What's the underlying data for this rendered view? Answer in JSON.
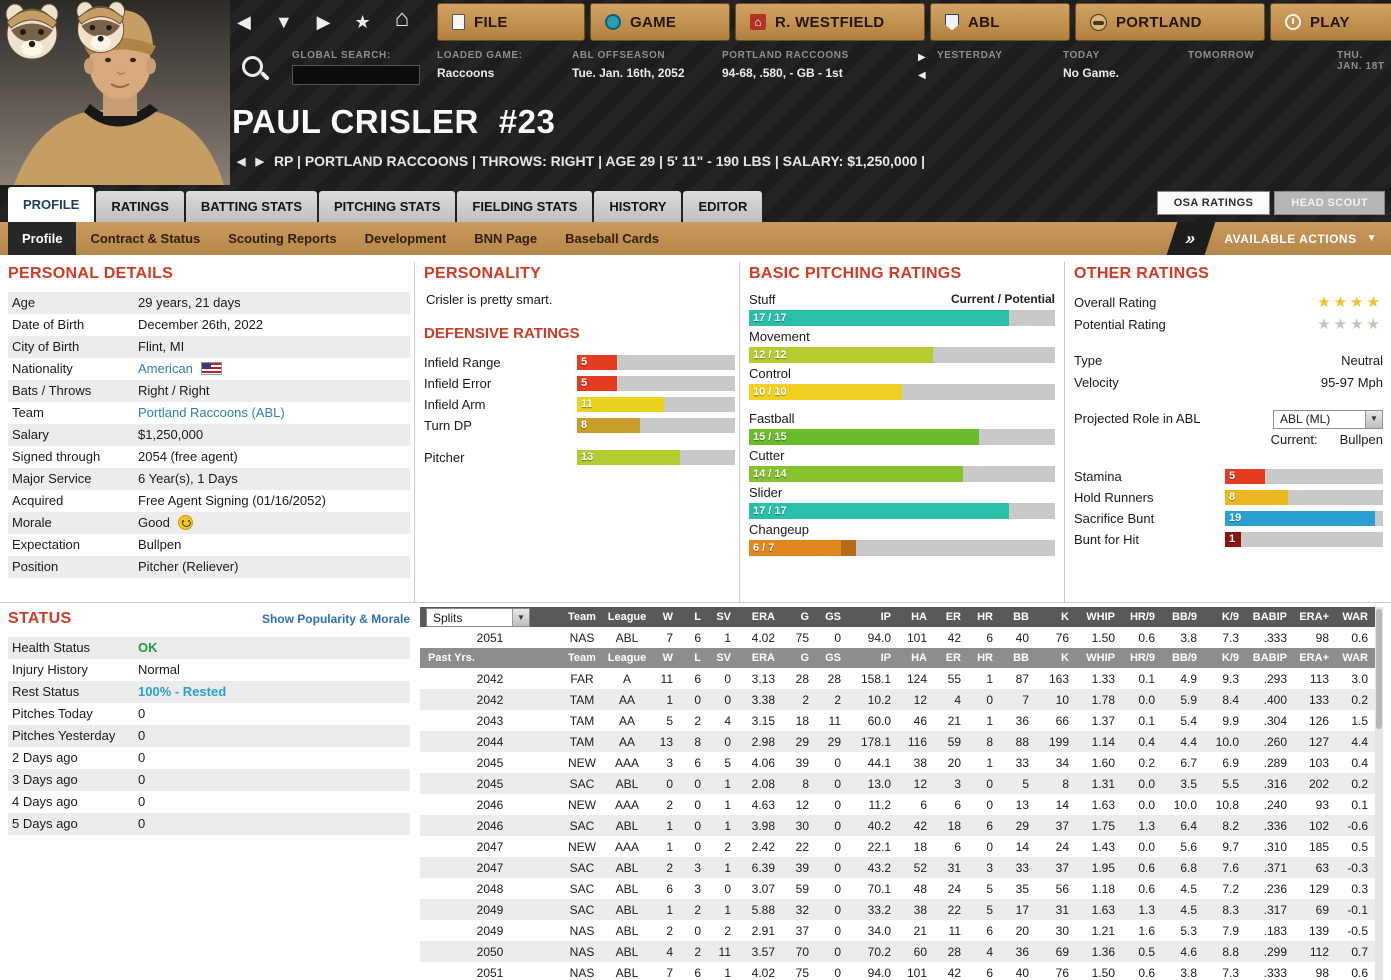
{
  "topbar": {
    "nav_icons": [
      {
        "name": "back-icon",
        "glyph": "◀"
      },
      {
        "name": "dropdown-icon",
        "glyph": "▼"
      },
      {
        "name": "forward-icon",
        "glyph": "▶"
      },
      {
        "name": "favorites-icon",
        "glyph": "★"
      },
      {
        "name": "home-icon",
        "glyph": "⌂"
      }
    ],
    "menus": [
      {
        "id": "file",
        "label": "FILE",
        "icon": "file-icon"
      },
      {
        "id": "game",
        "label": "GAME",
        "icon": "globe-icon"
      },
      {
        "id": "manager",
        "label": "R. WESTFIELD",
        "icon": "house-icon"
      },
      {
        "id": "league",
        "label": "ABL",
        "icon": "league-logo-icon"
      },
      {
        "id": "team",
        "label": "PORTLAND",
        "icon": "team-logo-icon"
      },
      {
        "id": "play",
        "label": "PLAY",
        "icon": "play-icon"
      }
    ]
  },
  "infobar": {
    "search_label": "GLOBAL SEARCH:",
    "search_value": "",
    "loaded_label": "LOADED GAME:",
    "loaded_value": "Raccoons",
    "league_label": "ABL OFFSEASON",
    "league_value": "Tue. Jan. 16th, 2052",
    "team_label": "PORTLAND RACCOONS",
    "team_value": "94-68, .580, - GB - 1st",
    "yesterday_label": "YESTERDAY",
    "today_label": "TODAY",
    "today_value": "No Game.",
    "tomorrow_label": "TOMORROW",
    "next_label": "THU. JAN. 18T"
  },
  "player": {
    "name": "PAUL CRISLER",
    "number": "#23",
    "subtitle": "RP | PORTLAND RACCOONS | THROWS: RIGHT | AGE 29 | 5' 11\" - 190 LBS | SALARY: $1,250,000 |"
  },
  "tabs": [
    {
      "label": "PROFILE",
      "active": true
    },
    {
      "label": "RATINGS"
    },
    {
      "label": "BATTING STATS"
    },
    {
      "label": "PITCHING STATS"
    },
    {
      "label": "FIELDING STATS"
    },
    {
      "label": "HISTORY"
    },
    {
      "label": "EDITOR"
    }
  ],
  "header_buttons": [
    {
      "label": "OSA RATINGS",
      "active": true
    },
    {
      "label": "HEAD SCOUT"
    }
  ],
  "subtabs": [
    {
      "label": "Profile",
      "active": true
    },
    {
      "label": "Contract & Status"
    },
    {
      "label": "Scouting Reports"
    },
    {
      "label": "Development"
    },
    {
      "label": "BNN Page"
    },
    {
      "label": "Baseball Cards"
    }
  ],
  "available_actions_label": "AVAILABLE ACTIONS",
  "personal_details": {
    "title": "PERSONAL DETAILS",
    "rows": [
      {
        "label": "Age",
        "value": "29 years, 21 days"
      },
      {
        "label": "Date of Birth",
        "value": "December 26th, 2022"
      },
      {
        "label": "City of Birth",
        "value": "Flint, MI"
      },
      {
        "label": "Nationality",
        "value": "American",
        "link": true,
        "suffix": "flag"
      },
      {
        "label": "Bats / Throws",
        "value": "Right / Right"
      },
      {
        "label": "Team",
        "value": "Portland Raccoons (ABL)",
        "link": true
      },
      {
        "label": "Salary",
        "value": "$1,250,000"
      },
      {
        "label": "Signed through",
        "value": "2054 (free agent)"
      },
      {
        "label": "Major Service",
        "value": "6 Year(s), 1 Days"
      },
      {
        "label": "Acquired",
        "value": "Free Agent Signing (01/16/2052)"
      },
      {
        "label": "Morale",
        "value": "Good",
        "suffix": "smiley"
      },
      {
        "label": "Expectation",
        "value": "Bullpen"
      },
      {
        "label": "Position",
        "value": "Pitcher (Reliever)"
      }
    ]
  },
  "personality": {
    "title": "PERSONALITY",
    "text": "Crisler is pretty smart.",
    "defensive_title": "DEFENSIVE RATINGS",
    "ratings": [
      {
        "label": "Infield Range",
        "value": 5,
        "color": "#e23d1f"
      },
      {
        "label": "Infield Error",
        "value": 5,
        "color": "#e23d1f"
      },
      {
        "label": "Infield Arm",
        "value": 11,
        "color": "#ead31f"
      },
      {
        "label": "Turn DP",
        "value": 8,
        "color": "#c79e2b"
      },
      {
        "label": "Pitcher",
        "value": 13,
        "color": "#b5cc30",
        "gap": true
      }
    ]
  },
  "pitching": {
    "title": "BASIC PITCHING RATINGS",
    "header_right": "Current / Potential",
    "ratings": [
      {
        "label": "Stuff",
        "current": 17,
        "potential": 17,
        "color": "#29bfa8"
      },
      {
        "label": "Movement",
        "current": 12,
        "potential": 12,
        "color": "#b8cc30"
      },
      {
        "label": "Control",
        "current": 10,
        "potential": 10,
        "color": "#f0d122"
      },
      {
        "label": "Fastball",
        "current": 15,
        "potential": 15,
        "color": "#68bb2a",
        "gap": true
      },
      {
        "label": "Cutter",
        "current": 14,
        "potential": 14,
        "color": "#86c22b"
      },
      {
        "label": "Slider",
        "current": 17,
        "potential": 17,
        "color": "#29bfa8"
      },
      {
        "label": "Changeup",
        "current": 6,
        "potential": 7,
        "color": "#e2861f",
        "potential_color": "#b96a15"
      }
    ]
  },
  "other": {
    "title": "OTHER RATINGS",
    "overall_label": "Overall Rating",
    "overall_stars": {
      "count": 4,
      "color": "#f0c222"
    },
    "potential_label": "Potential Rating",
    "potential_stars": {
      "count": 4,
      "color": "#cbc2b4"
    },
    "type_label": "Type",
    "type_value": "Neutral",
    "velocity_label": "Velocity",
    "velocity_value": "95-97 Mph",
    "projected_label": "Projected Role in ABL",
    "projected_value": "ABL (ML)",
    "current_label": "Current:",
    "current_value": "Bullpen",
    "bars": [
      {
        "label": "Stamina",
        "value": 5,
        "color": "#e23d1f"
      },
      {
        "label": "Hold Runners",
        "value": 8,
        "color": "#eab81e"
      },
      {
        "label": "Sacrifice Bunt",
        "value": 19,
        "color": "#2b9fd1"
      },
      {
        "label": "Bunt for Hit",
        "value": 1,
        "color": "#8c1511"
      }
    ]
  },
  "status": {
    "title": "STATUS",
    "link": "Show Popularity & Morale",
    "rows": [
      {
        "label": "Health Status",
        "value": "OK",
        "color": "#1e9e40"
      },
      {
        "label": "Injury History",
        "value": "Normal"
      },
      {
        "label": "Rest Status",
        "value": "100% - Rested",
        "color": "#2a9fd4"
      },
      {
        "label": "Pitches Today",
        "value": "0"
      },
      {
        "label": "Pitches Yesterday",
        "value": "0"
      },
      {
        "label": "2 Days ago",
        "value": "0"
      },
      {
        "label": "3 Days ago",
        "value": "0"
      },
      {
        "label": "4 Days ago",
        "value": "0"
      },
      {
        "label": "5 Days ago",
        "value": "0"
      }
    ]
  },
  "stats": {
    "splits_label": "Splits",
    "past_label": "Past Yrs.",
    "columns": [
      "Team",
      "League",
      "W",
      "L",
      "SV",
      "ERA",
      "G",
      "GS",
      "IP",
      "HA",
      "ER",
      "HR",
      "BB",
      "K",
      "WHIP",
      "HR/9",
      "BB/9",
      "K/9",
      "BABIP",
      "ERA+",
      "WAR"
    ],
    "current_row": [
      "2051",
      "NAS",
      "ABL",
      "7",
      "6",
      "1",
      "4.02",
      "75",
      "0",
      "94.0",
      "101",
      "42",
      "6",
      "40",
      "76",
      "1.50",
      "0.6",
      "3.8",
      "7.3",
      ".333",
      "98",
      "0.6"
    ],
    "rows": [
      [
        "2042",
        "FAR",
        "A",
        "11",
        "6",
        "0",
        "3.13",
        "28",
        "28",
        "158.1",
        "124",
        "55",
        "1",
        "87",
        "163",
        "1.33",
        "0.1",
        "4.9",
        "9.3",
        ".293",
        "113",
        "3.0"
      ],
      [
        "2042",
        "TAM",
        "AA",
        "1",
        "0",
        "0",
        "3.38",
        "2",
        "2",
        "10.2",
        "12",
        "4",
        "0",
        "7",
        "10",
        "1.78",
        "0.0",
        "5.9",
        "8.4",
        ".400",
        "133",
        "0.2"
      ],
      [
        "2043",
        "TAM",
        "AA",
        "5",
        "2",
        "4",
        "3.15",
        "18",
        "11",
        "60.0",
        "46",
        "21",
        "1",
        "36",
        "66",
        "1.37",
        "0.1",
        "5.4",
        "9.9",
        ".304",
        "126",
        "1.5"
      ],
      [
        "2044",
        "TAM",
        "AA",
        "13",
        "8",
        "0",
        "2.98",
        "29",
        "29",
        "178.1",
        "116",
        "59",
        "8",
        "88",
        "199",
        "1.14",
        "0.4",
        "4.4",
        "10.0",
        ".260",
        "127",
        "4.4"
      ],
      [
        "2045",
        "NEW",
        "AAA",
        "3",
        "6",
        "5",
        "4.06",
        "39",
        "0",
        "44.1",
        "38",
        "20",
        "1",
        "33",
        "34",
        "1.60",
        "0.2",
        "6.7",
        "6.9",
        ".289",
        "103",
        "0.4"
      ],
      [
        "2045",
        "SAC",
        "ABL",
        "0",
        "0",
        "1",
        "2.08",
        "8",
        "0",
        "13.0",
        "12",
        "3",
        "0",
        "5",
        "8",
        "1.31",
        "0.0",
        "3.5",
        "5.5",
        ".316",
        "202",
        "0.2"
      ],
      [
        "2046",
        "NEW",
        "AAA",
        "2",
        "0",
        "1",
        "4.63",
        "12",
        "0",
        "11.2",
        "6",
        "6",
        "0",
        "13",
        "14",
        "1.63",
        "0.0",
        "10.0",
        "10.8",
        ".240",
        "93",
        "0.1"
      ],
      [
        "2046",
        "SAC",
        "ABL",
        "1",
        "0",
        "1",
        "3.98",
        "30",
        "0",
        "40.2",
        "42",
        "18",
        "6",
        "29",
        "37",
        "1.75",
        "1.3",
        "6.4",
        "8.2",
        ".336",
        "102",
        "-0.6"
      ],
      [
        "2047",
        "NEW",
        "AAA",
        "1",
        "0",
        "2",
        "2.42",
        "22",
        "0",
        "22.1",
        "18",
        "6",
        "0",
        "14",
        "24",
        "1.43",
        "0.0",
        "5.6",
        "9.7",
        ".310",
        "185",
        "0.5"
      ],
      [
        "2047",
        "SAC",
        "ABL",
        "2",
        "3",
        "1",
        "6.39",
        "39",
        "0",
        "43.2",
        "52",
        "31",
        "3",
        "33",
        "37",
        "1.95",
        "0.6",
        "6.8",
        "7.6",
        ".371",
        "63",
        "-0.3"
      ],
      [
        "2048",
        "SAC",
        "ABL",
        "6",
        "3",
        "0",
        "3.07",
        "59",
        "0",
        "70.1",
        "48",
        "24",
        "5",
        "35",
        "56",
        "1.18",
        "0.6",
        "4.5",
        "7.2",
        ".236",
        "129",
        "0.3"
      ],
      [
        "2049",
        "SAC",
        "ABL",
        "1",
        "2",
        "1",
        "5.88",
        "32",
        "0",
        "33.2",
        "38",
        "22",
        "5",
        "17",
        "31",
        "1.63",
        "1.3",
        "4.5",
        "8.3",
        ".317",
        "69",
        "-0.1"
      ],
      [
        "2049",
        "NAS",
        "ABL",
        "2",
        "0",
        "2",
        "2.91",
        "37",
        "0",
        "34.0",
        "21",
        "11",
        "6",
        "20",
        "30",
        "1.21",
        "1.6",
        "5.3",
        "7.9",
        ".183",
        "139",
        "-0.5"
      ],
      [
        "2050",
        "NAS",
        "ABL",
        "4",
        "2",
        "11",
        "3.57",
        "70",
        "0",
        "70.2",
        "60",
        "28",
        "4",
        "36",
        "69",
        "1.36",
        "0.5",
        "4.6",
        "8.8",
        ".299",
        "112",
        "0.7"
      ],
      [
        "2051",
        "NAS",
        "ABL",
        "7",
        "6",
        "1",
        "4.02",
        "75",
        "0",
        "94.0",
        "101",
        "42",
        "6",
        "40",
        "76",
        "1.50",
        "0.6",
        "3.8",
        "7.3",
        ".333",
        "98",
        "0.6"
      ]
    ]
  }
}
